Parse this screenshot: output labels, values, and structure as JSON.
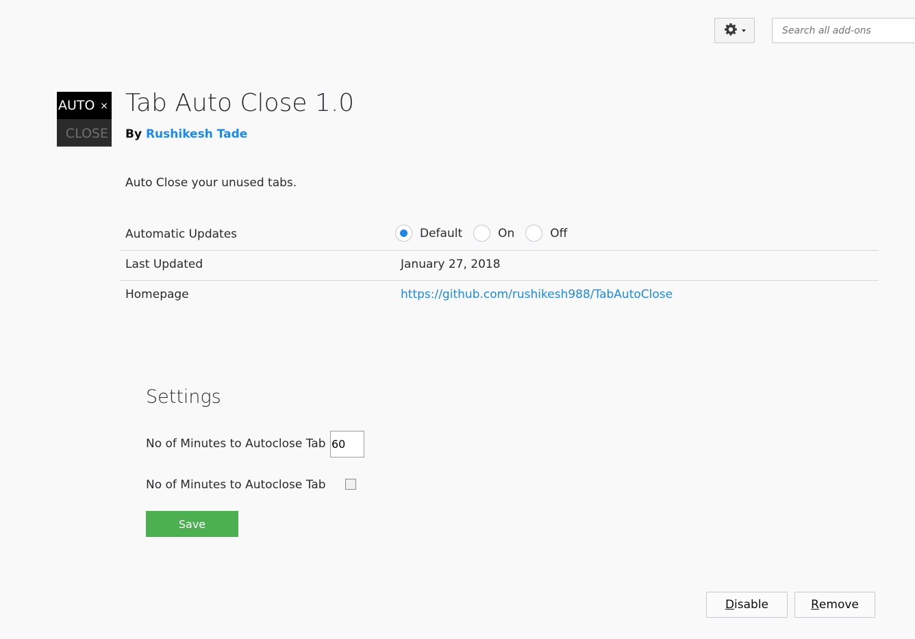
{
  "toolbar": {
    "gear_icon": "gear-icon",
    "search_placeholder": "Search all add-ons"
  },
  "addon": {
    "icon": {
      "top_text": "AUTO",
      "close_glyph": "×",
      "bottom_text": "CLOSE"
    },
    "title": "Tab Auto Close 1.0",
    "by_label": "By",
    "author": "Rushikesh Tade",
    "description": "Auto Close your unused tabs."
  },
  "details": {
    "automatic_updates": {
      "label": "Automatic Updates",
      "options": [
        "Default",
        "On",
        "Off"
      ],
      "selected": "Default"
    },
    "last_updated": {
      "label": "Last Updated",
      "value": "January 27, 2018"
    },
    "homepage": {
      "label": "Homepage",
      "value": "https://github.com/rushikesh988/TabAutoClose"
    }
  },
  "settings": {
    "title": "Settings",
    "minutes_label": "No of Minutes to Autoclose Tab",
    "minutes_value": "60",
    "checkbox_label": "No of Minutes to Autoclose Tab",
    "checkbox_checked": false,
    "save_label": "Save"
  },
  "actions": {
    "disable_first": "D",
    "disable_rest": "isable",
    "remove_first": "R",
    "remove_rest": "emove"
  },
  "colors": {
    "link": "#1e88e5",
    "save_button": "#4caf50",
    "background": "#f9f9fa"
  }
}
